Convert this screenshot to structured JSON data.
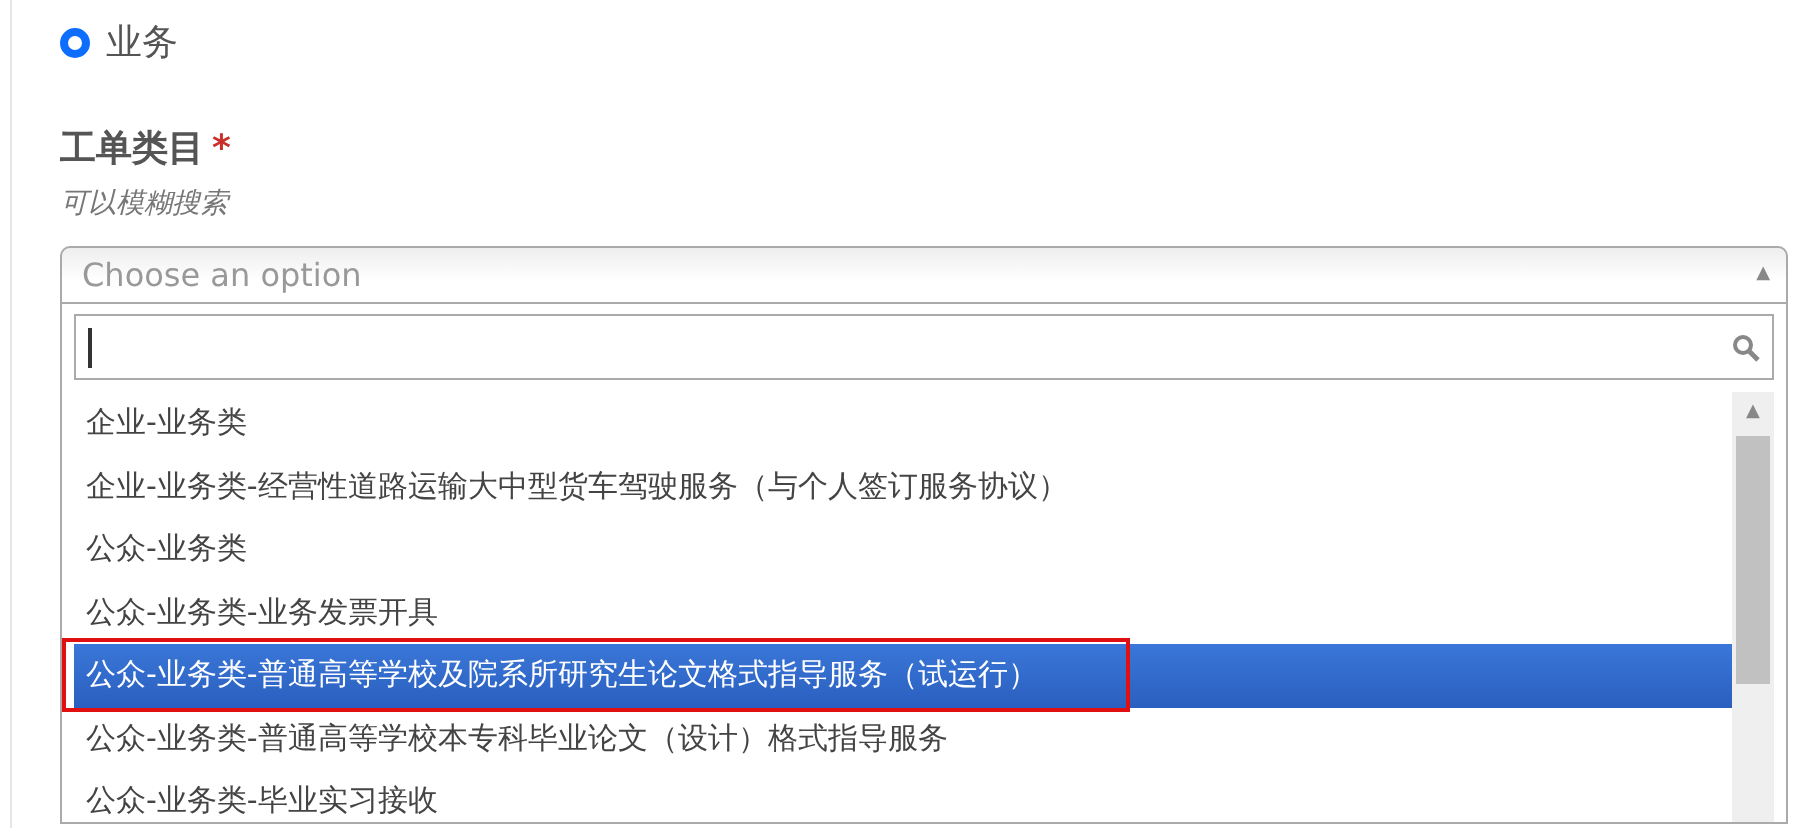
{
  "radio": {
    "label": "业务",
    "selected": true
  },
  "field": {
    "label": "工单类目",
    "required_mark": "*",
    "hint": "可以模糊搜索"
  },
  "select": {
    "placeholder": "Choose an option",
    "expanded": true,
    "arrow": "▲"
  },
  "options": [
    {
      "label": "企业-业务类",
      "selected": false,
      "annotated": false
    },
    {
      "label": "企业-业务类-经营性道路运输大中型货车驾驶服务（与个人签订服务协议）",
      "selected": false,
      "annotated": false
    },
    {
      "label": "公众-业务类",
      "selected": false,
      "annotated": false
    },
    {
      "label": "公众-业务类-业务发票开具",
      "selected": false,
      "annotated": false
    },
    {
      "label": "公众-业务类-普通高等学校及院系所研究生论文格式指导服务（试运行）",
      "selected": true,
      "annotated": true
    },
    {
      "label": "公众-业务类-普通高等学校本专科毕业论文（设计）格式指导服务",
      "selected": false,
      "annotated": false
    },
    {
      "label": "公众-业务类-毕业实习接收",
      "selected": false,
      "annotated": false
    }
  ]
}
